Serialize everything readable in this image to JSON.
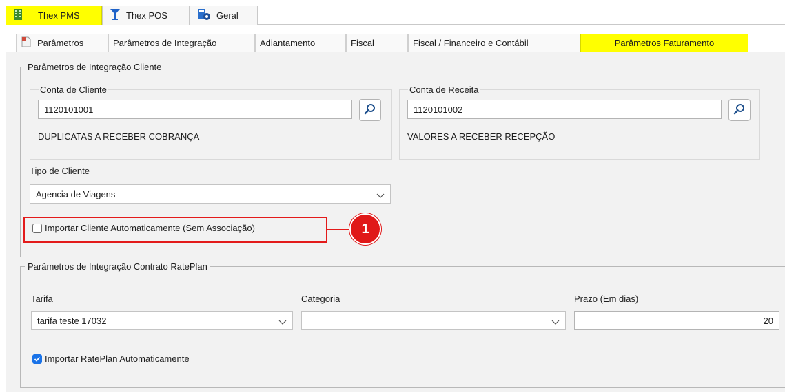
{
  "app_tabs": [
    {
      "label": "Thex PMS",
      "icon": "building-icon",
      "active": true
    },
    {
      "label": "Thex POS",
      "icon": "cocktail-glass-icon",
      "active": false
    },
    {
      "label": "Geral",
      "icon": "settings-doc-icon",
      "active": false
    }
  ],
  "sub_tabs": [
    {
      "label": "Parâmetros",
      "icon": "document-icon"
    },
    {
      "label": "Parâmetros de Integração"
    },
    {
      "label": "Adiantamento"
    },
    {
      "label": "Fiscal"
    },
    {
      "label": "Fiscal / Financeiro e Contábil"
    },
    {
      "label": "Parâmetros Faturamento",
      "active": true
    }
  ],
  "cliente_section": {
    "legend": "Parâmetros de Integração Cliente",
    "conta_cliente": {
      "title": "Conta de Cliente",
      "value": "1120101001",
      "description": "DUPLICATAS A RECEBER COBRANÇA"
    },
    "conta_receita": {
      "title": "Conta de Receita",
      "value": "1120101002",
      "description": "VALORES A RECEBER RECEPÇÃO"
    },
    "tipo_cliente": {
      "label": "Tipo de Cliente",
      "value": "Agencia de Viagens"
    },
    "importar_cliente": {
      "label": "Importar Cliente Automaticamente (Sem Associação)",
      "checked": false
    }
  },
  "rateplan_section": {
    "legend": "Parâmetros de Integração Contrato RatePlan",
    "tarifa": {
      "label": "Tarifa",
      "value": "tarifa teste 17032"
    },
    "categoria": {
      "label": "Categoria",
      "value": ""
    },
    "prazo": {
      "label": "Prazo (Em dias)",
      "value": "20"
    },
    "importar_rateplan": {
      "label": "Importar RatePlan Automaticamente",
      "checked": true
    }
  },
  "callout": {
    "number": "1"
  },
  "colors": {
    "highlight_tab": "#ffff00",
    "callout_red": "#e01818",
    "checkbox_blue": "#1a73e8"
  }
}
